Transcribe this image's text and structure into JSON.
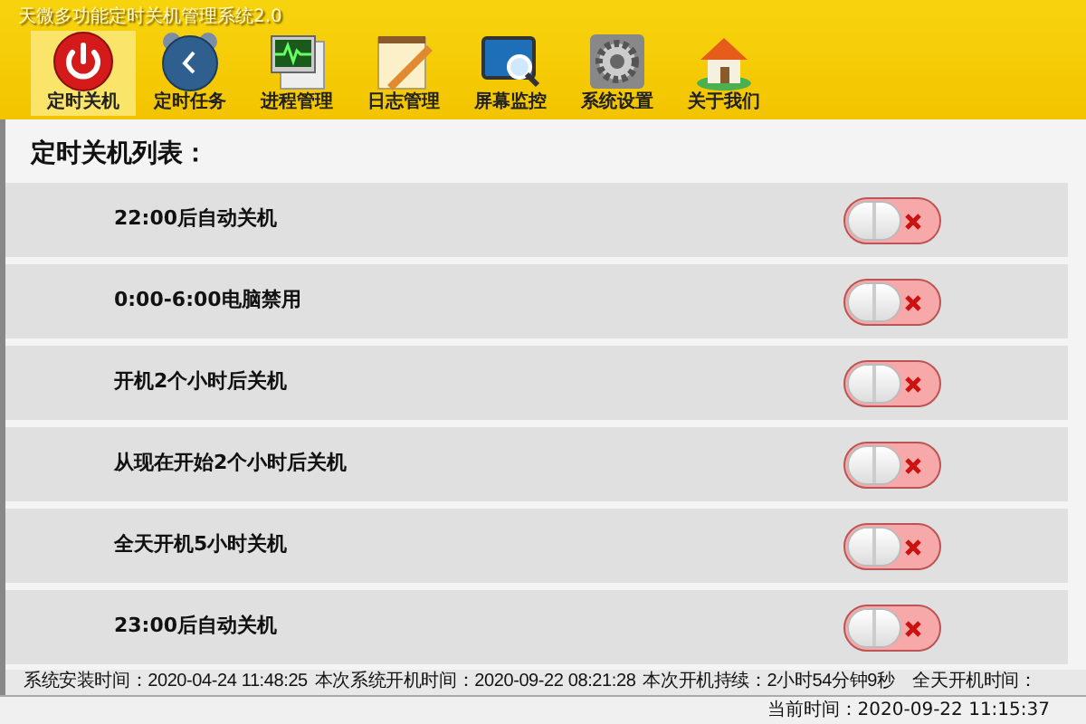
{
  "window": {
    "title": "天微多功能定时关机管理系统2.0"
  },
  "toolbar": [
    {
      "label": "定时关机",
      "selected": true
    },
    {
      "label": "定时任务",
      "selected": false
    },
    {
      "label": "进程管理",
      "selected": false
    },
    {
      "label": "日志管理",
      "selected": false
    },
    {
      "label": "屏幕监控",
      "selected": false
    },
    {
      "label": "系统设置",
      "selected": false
    },
    {
      "label": "关于我们",
      "selected": false
    }
  ],
  "list": {
    "heading": "定时关机列表：",
    "items": [
      {
        "label": "22:00后自动关机",
        "on": false
      },
      {
        "label": "0:00-6:00电脑禁用",
        "on": false
      },
      {
        "label": "开机2个小时后关机",
        "on": false
      },
      {
        "label": "从现在开始2个小时后关机",
        "on": false
      },
      {
        "label": "全天开机5小时关机",
        "on": false
      },
      {
        "label": "23:00后自动关机",
        "on": false
      }
    ]
  },
  "status_bar": {
    "info": [
      "系统安装时间：2020-04-24 11:48:25",
      "本次系统开机时间：2020-09-22 08:21:28",
      "本次开机持续：2小时54分钟9秒",
      "全天开机时间："
    ],
    "current_time": "当前时间：2020-09-22 11:15:37"
  }
}
